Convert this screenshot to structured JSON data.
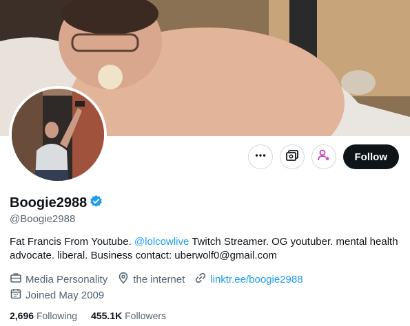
{
  "profile": {
    "display_name": "Boogie2988",
    "handle": "@Boogie2988",
    "verified": true,
    "bio_before": "Fat Francis From Youtube. ",
    "bio_mention": "@lolcowlive",
    "bio_after": " Twitch Streamer. OG youtuber. mental health advocate. liberal. Business contact: uberwolf0@gmail.com",
    "category": "Media Personality",
    "location": "the internet",
    "website": "linktr.ee/boogie2988",
    "joined": "Joined May 2009"
  },
  "stats": {
    "following_count": "2,696",
    "following_label": "Following",
    "followers_count": "455.1K",
    "followers_label": "Followers"
  },
  "actions": {
    "follow_label": "Follow"
  },
  "colors": {
    "accent": "#1d9bf0",
    "subscribe": "#c73ec0",
    "follow_bg": "#0f1419",
    "secondary_text": "#536471"
  },
  "icons": [
    "more-icon",
    "subscribe-money-icon",
    "subscribe-person-icon",
    "verified-badge-icon",
    "briefcase-icon",
    "location-pin-icon",
    "link-icon",
    "calendar-icon"
  ]
}
